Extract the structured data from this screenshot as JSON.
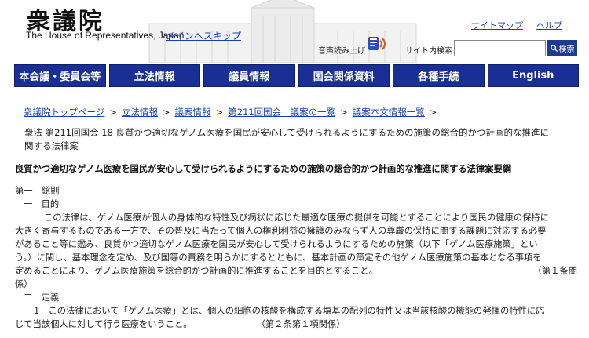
{
  "header": {
    "logo_jp": "衆議院",
    "logo_en": "The House of Representatives, Japan",
    "skip_link": "メインへスキップ",
    "sitemap": "サイトマップ",
    "help": "ヘルプ",
    "tts_label": "音声読み上げ",
    "search_label": "サイト内検索",
    "search_value": "",
    "search_button": "検索"
  },
  "nav": {
    "items": [
      {
        "label": "本会議・委員会等"
      },
      {
        "label": "立法情報"
      },
      {
        "label": "議員情報"
      },
      {
        "label": "国会関係資料"
      },
      {
        "label": "各種手続"
      },
      {
        "label": "English"
      }
    ]
  },
  "breadcrumb": {
    "items": [
      {
        "label": "衆議院トップページ"
      },
      {
        "label": "立法情報"
      },
      {
        "label": "議案情報"
      },
      {
        "label": "第211回国会　議案の一覧"
      },
      {
        "label": "議案本文情報一覧"
      }
    ],
    "separator": ">"
  },
  "doc": {
    "title_line1": "衆法 第211回国会 18 良質かつ適切なゲノム医療を国民が安心して受けられるようにするための施策の総合的かつ計画的な推進に",
    "title_line2": "関する法律案",
    "heading": "良質かつ適切なゲノム医療を国民が安心して受けられるようにするための施策の総合的かつ計画的な推進に関する法律案要綱",
    "section1": "第一　総則",
    "sub1": "一　目的",
    "para1": [
      "この法律は、ゲノム医療が個人の身体的な特性及び病状に応じた最適な医療の提供を可能とすることにより国民の健康の保持に",
      "大きく寄与するものである一方で、その普及に当たって個人の権利利益の擁護のみならず人の尊厳の保持に関する課題に対応する必要",
      "があること等に鑑み、良質かつ適切なゲノム医療を国民が安心して受けられるようにするための施策（以下「ゲノム医療施策」とい",
      "う。）に関し、基本理念を定め、及び国等の責務を明らかにするとともに、基本計画の策定その他ゲノム医療施策の基本となる事項を",
      "定めることにより、ゲノム医療施策を総合的かつ計画的に推進することを目的とすること。"
    ],
    "ref1a": "（第１条関",
    "ref1b": "係）",
    "sub2": "二　定義",
    "para2_line1": "1　この法律において「ゲノム医療」とは、個人の細胞の核酸を構成する塩基の配列の特性又は当該核酸の機能の発揮の特性に応",
    "para2_line2": "じて当該個人に対して行う医療をいうこと。",
    "ref2": "（第２条第１項関係）"
  }
}
